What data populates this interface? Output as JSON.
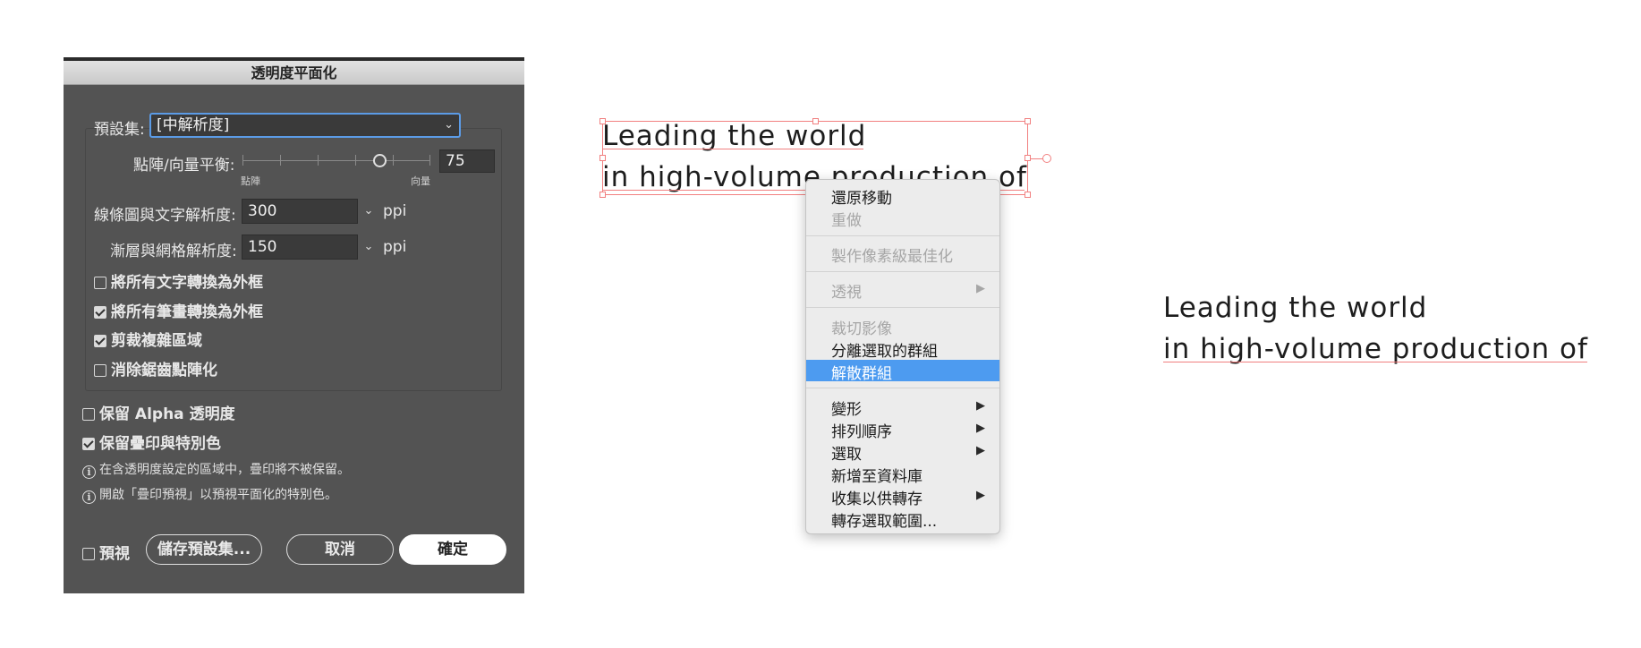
{
  "dialog": {
    "title": "透明度平面化",
    "preset_label": "預設集:",
    "preset_value": "[中解析度]",
    "balance_label": "點陣/向量平衡:",
    "balance_value": "75",
    "balance_min_label": "點陣",
    "balance_max_label": "向量",
    "balance_level": 0.75,
    "line_art_label": "線條圖與文字解析度:",
    "line_art_value": "300",
    "gradient_label": "漸層與網格解析度:",
    "gradient_value": "150",
    "unit_ppi": "ppi",
    "checkboxes": [
      {
        "label": "將所有文字轉換為外框",
        "checked": false
      },
      {
        "label": "將所有筆畫轉換為外框",
        "checked": true
      },
      {
        "label": "剪裁複雜區域",
        "checked": true
      },
      {
        "label": "消除鋸齒點陣化",
        "checked": false
      }
    ],
    "preserve_alpha_label": "保留 Alpha 透明度",
    "preserve_alpha_checked": false,
    "preserve_overprint_label": "保留疊印與特別色",
    "preserve_overprint_checked": true,
    "info_1": "在含透明度設定的區域中，疊印將不被保留。",
    "info_2": "開啟「疊印預視」以預視平面化的特別色。",
    "preview_label": "預視",
    "preview_checked": false,
    "save_preset_button": "儲存預設集...",
    "cancel_button": "取消",
    "ok_button": "確定",
    "accent_color": "#5b9be6"
  },
  "artboard": {
    "selected_text_line1": "Leading the world",
    "selected_text_line2": "in high-volume production of",
    "plain_text_line1": "Leading the world",
    "plain_text_line2": "in high-volume production of",
    "selection_color": "#f18080"
  },
  "context_menu": {
    "items": [
      {
        "label": "還原移動",
        "enabled": true
      },
      {
        "label": "重做",
        "enabled": false
      },
      {
        "label": "製作像素級最佳化",
        "enabled": false
      },
      {
        "label": "透視",
        "enabled": false,
        "submenu": true
      },
      {
        "label": "裁切影像",
        "enabled": false
      },
      {
        "label": "分離選取的群組",
        "enabled": true
      },
      {
        "label": "解散群組",
        "enabled": true,
        "highlighted": true
      },
      {
        "label": "變形",
        "enabled": true,
        "submenu": true
      },
      {
        "label": "排列順序",
        "enabled": true,
        "submenu": true
      },
      {
        "label": "選取",
        "enabled": true,
        "submenu": true
      },
      {
        "label": "新增至資料庫",
        "enabled": true
      },
      {
        "label": "收集以供轉存",
        "enabled": true,
        "submenu": true
      },
      {
        "label": "轉存選取範圍...",
        "enabled": true
      }
    ],
    "submenu_glyph": "▶",
    "highlight_color": "#4d9bf0"
  }
}
